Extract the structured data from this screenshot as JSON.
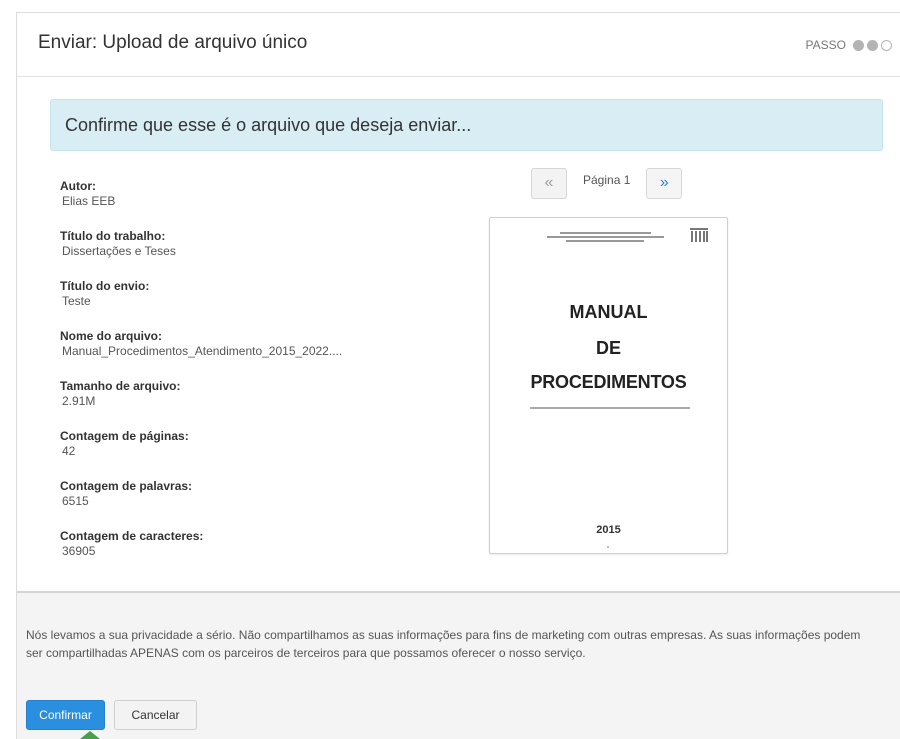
{
  "header": {
    "title": "Enviar: Upload de arquivo único",
    "step_label": "PASSO",
    "steps_total": 3,
    "steps_done": 2
  },
  "banner": {
    "text": "Confirme que esse é o arquivo que deseja enviar..."
  },
  "metadata": [
    {
      "key": "Autor:",
      "value": "Elias EEB"
    },
    {
      "key": "Título do trabalho:",
      "value": "Dissertações e Teses"
    },
    {
      "key": "Título do envio:",
      "value": "Teste"
    },
    {
      "key": "Nome do arquivo:",
      "value": "Manual_Procedimentos_Atendimento_2015_2022...."
    },
    {
      "key": "Tamanho de arquivo:",
      "value": "2.91M"
    },
    {
      "key": "Contagem de páginas:",
      "value": "42"
    },
    {
      "key": "Contagem de palavras:",
      "value": "6515"
    },
    {
      "key": "Contagem de caracteres:",
      "value": "36905"
    }
  ],
  "pager": {
    "prev": "«",
    "label": "Página 1",
    "next": "»"
  },
  "preview": {
    "title_line1": "MANUAL",
    "title_line2": "DE",
    "title_line3": "PROCEDIMENTOS",
    "year": "2015"
  },
  "footer": {
    "privacy": "Nós levamos a sua privacidade a sério. Não compartilhamos as suas informações para fins de marketing com outras empresas. As suas informações podem ser compartilhadas APENAS com os parceiros de terceiros para que possamos oferecer o nosso serviço.",
    "confirm_label": "Confirmar",
    "cancel_label": "Cancelar"
  },
  "colors": {
    "primary": "#2b8fe0",
    "banner_bg": "#d9edf4",
    "next_arrow": "#2d86d8"
  }
}
